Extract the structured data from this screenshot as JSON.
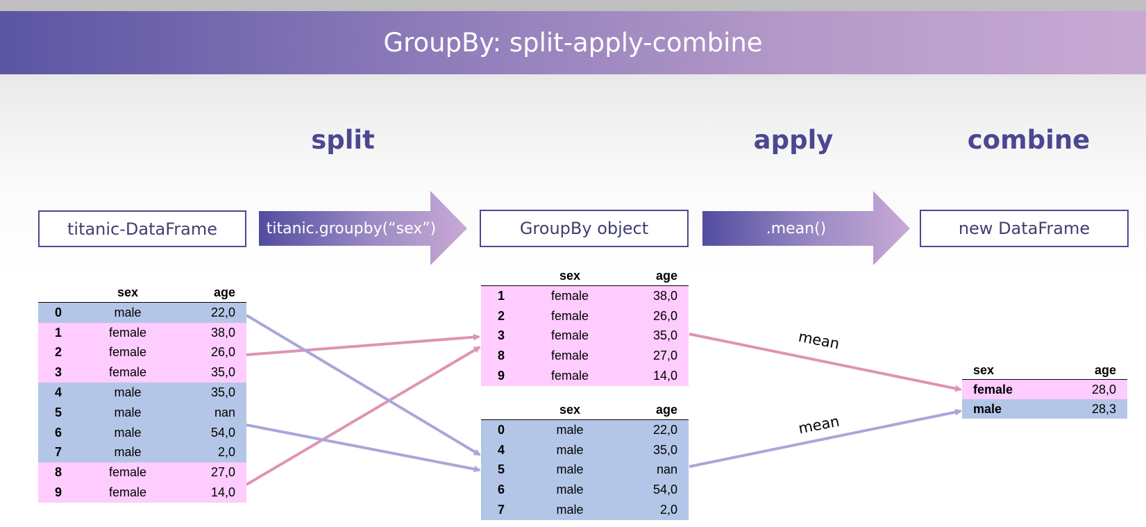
{
  "title": "GroupBy: split-apply-combine",
  "stages": {
    "split": "split",
    "apply": "apply",
    "combine": "combine"
  },
  "boxes": {
    "source": "titanic-DataFrame",
    "groupby_call": "titanic.groupby(“sex”)",
    "groupby_object": "GroupBy object",
    "mean_call": ".mean()",
    "result": "new DataFrame"
  },
  "columns": {
    "sex": "sex",
    "age": "age"
  },
  "source_rows": [
    {
      "idx": "0",
      "sex": "male",
      "age": "22,0"
    },
    {
      "idx": "1",
      "sex": "female",
      "age": "38,0"
    },
    {
      "idx": "2",
      "sex": "female",
      "age": "26,0"
    },
    {
      "idx": "3",
      "sex": "female",
      "age": "35,0"
    },
    {
      "idx": "4",
      "sex": "male",
      "age": "35,0"
    },
    {
      "idx": "5",
      "sex": "male",
      "age": "nan"
    },
    {
      "idx": "6",
      "sex": "male",
      "age": "54,0"
    },
    {
      "idx": "7",
      "sex": "male",
      "age": "2,0"
    },
    {
      "idx": "8",
      "sex": "female",
      "age": "27,0"
    },
    {
      "idx": "9",
      "sex": "female",
      "age": "14,0"
    }
  ],
  "female_group": [
    {
      "idx": "1",
      "sex": "female",
      "age": "38,0"
    },
    {
      "idx": "2",
      "sex": "female",
      "age": "26,0"
    },
    {
      "idx": "3",
      "sex": "female",
      "age": "35,0"
    },
    {
      "idx": "8",
      "sex": "female",
      "age": "27,0"
    },
    {
      "idx": "9",
      "sex": "female",
      "age": "14,0"
    }
  ],
  "male_group": [
    {
      "idx": "0",
      "sex": "male",
      "age": "22,0"
    },
    {
      "idx": "4",
      "sex": "male",
      "age": "35,0"
    },
    {
      "idx": "5",
      "sex": "male",
      "age": "nan"
    },
    {
      "idx": "6",
      "sex": "male",
      "age": "54,0"
    },
    {
      "idx": "7",
      "sex": "male",
      "age": "2,0"
    }
  ],
  "result_rows": [
    {
      "sex": "female",
      "age": "28,0"
    },
    {
      "sex": "male",
      "age": "28,3"
    }
  ],
  "mean_labels": {
    "female": "mean",
    "male": "mean"
  },
  "colors": {
    "banner_start": "#5b55a3",
    "banner_end": "#c7a9d4",
    "stage_text": "#4b4790",
    "female_row": "#ffccff",
    "male_row": "#b4c6e7",
    "female_line": "#df93b6",
    "male_line": "#a9a6da"
  }
}
